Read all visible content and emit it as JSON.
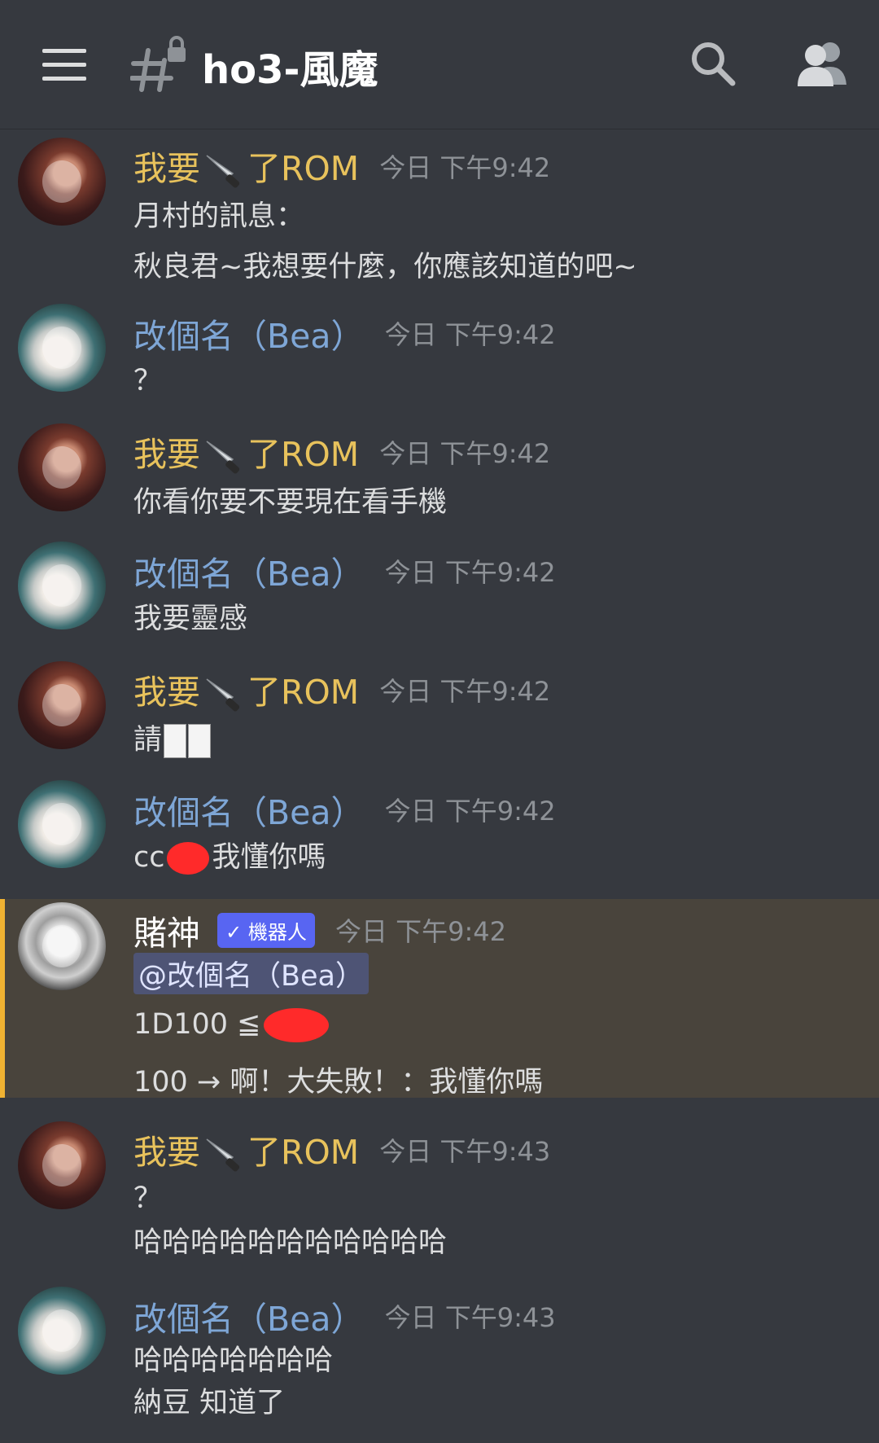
{
  "topbar": {
    "channel_name": "ho3-風魔",
    "icons": [
      "hamburger-menu-icon",
      "locked-channel-hash-icon",
      "search-icon",
      "members-icon"
    ]
  },
  "colors": {
    "background": "#36393f",
    "rom_name": "#e8c25c",
    "bea_name": "#7ea6d6",
    "timestamp": "#8e9297",
    "bot_badge": "#5865f2",
    "highlight_bg": "#49443c",
    "highlight_bar": "#f0b232",
    "mention_bg": "#4e5475"
  },
  "messages": [
    {
      "user_a": "我要",
      "user_b": "了ROM",
      "time": "今日 下午9:42",
      "lines": [
        "月村的訊息：",
        "秋良君~我想要什麼，你應該知道的吧~"
      ]
    },
    {
      "user": "改個名（Bea）",
      "time": "今日 下午9:42",
      "lines": [
        "？"
      ]
    },
    {
      "user_a": "我要",
      "user_b": "了ROM",
      "time": "今日 下午9:42",
      "lines": [
        "你看你要不要現在看手機"
      ]
    },
    {
      "user": "改個名（Bea）",
      "time": "今日 下午9:42",
      "lines": [
        "我要靈感"
      ]
    },
    {
      "user_a": "我要",
      "user_b": "了ROM",
      "time": "今日 下午9:42",
      "lines": [
        "請"
      ]
    },
    {
      "user": "改個名（Bea）",
      "time": "今日 下午9:42",
      "lines": [
        "cc",
        "我懂你嗎"
      ]
    },
    {
      "user": "賭神",
      "badge": "✓ 機器人",
      "time": "今日 下午9:42",
      "mention": "@改個名（Bea）",
      "lines": [
        "1D100 ≦",
        "100 → 啊！大失敗！：我懂你嗎"
      ]
    },
    {
      "user_a": "我要",
      "user_b": "了ROM",
      "time": "今日 下午9:43",
      "lines": [
        "？",
        "哈哈哈哈哈哈哈哈哈哈哈"
      ]
    },
    {
      "user": "改個名（Bea）",
      "time": "今日 下午9:43",
      "lines": [
        "哈哈哈哈哈哈哈",
        "納豆 知道了"
      ]
    }
  ]
}
